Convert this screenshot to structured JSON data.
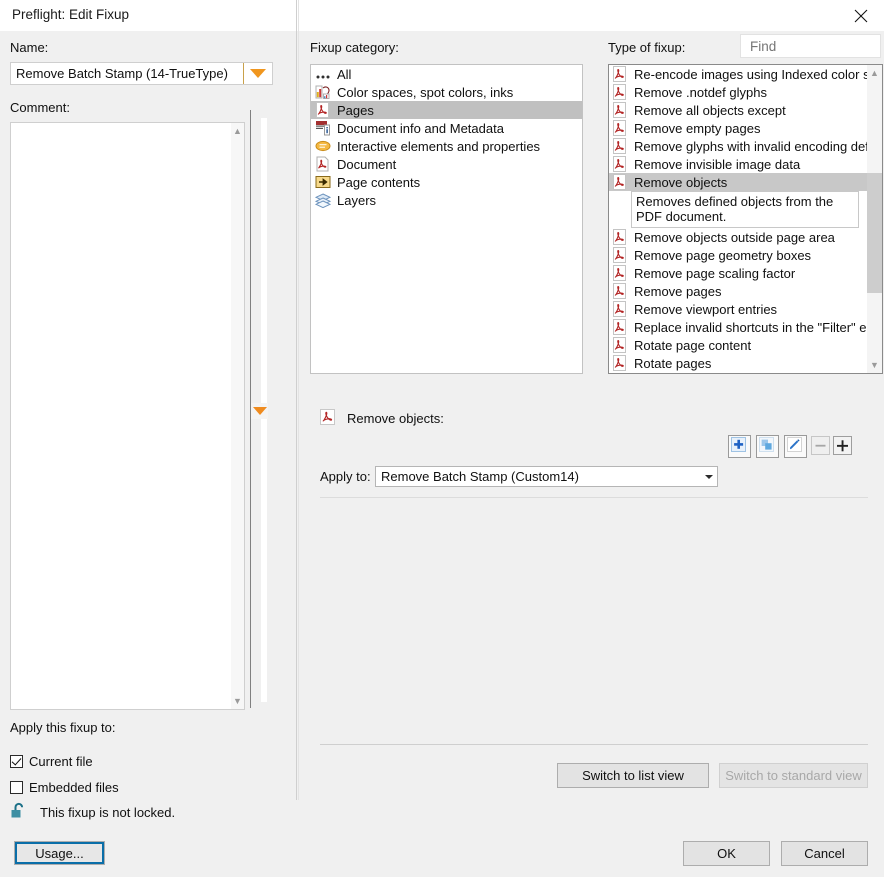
{
  "window": {
    "title": "Preflight: Edit Fixup",
    "close_icon": "close-icon"
  },
  "left_panel": {
    "name_label": "Name:",
    "name_value": "Remove Batch Stamp (14-TrueType)",
    "name_dropdown_icon": "chevron-down-icon",
    "comment_label": "Comment:",
    "comment_value": "",
    "apply_fixup_label": "Apply this fixup to:",
    "checkbox_current_file": {
      "label": "Current file",
      "checked": true
    },
    "checkbox_embedded_files": {
      "label": "Embedded files",
      "checked": false
    },
    "lock_icon": "unlocked-padlock-icon",
    "lock_text": "This fixup is not locked.",
    "usage_button": "Usage..."
  },
  "fixup_category": {
    "label": "Fixup category:",
    "items": [
      {
        "label": "All",
        "icon": "ellipsis-icon",
        "selected": false
      },
      {
        "label": "Color spaces, spot colors, inks",
        "icon": "color-swatch-icon",
        "selected": false
      },
      {
        "label": "Pages",
        "icon": "pdf-page-icon",
        "selected": true
      },
      {
        "label": "Document info and Metadata",
        "icon": "info-document-icon",
        "selected": false
      },
      {
        "label": "Interactive elements and properties",
        "icon": "comment-bubble-icon",
        "selected": false
      },
      {
        "label": "Document",
        "icon": "pdf-document-icon",
        "selected": false
      },
      {
        "label": "Page contents",
        "icon": "arrow-page-icon",
        "selected": false
      },
      {
        "label": "Layers",
        "icon": "layers-icon",
        "selected": false
      }
    ]
  },
  "type_of_fixup": {
    "label": "Type of fixup:",
    "find_placeholder": "Find",
    "find_value": "",
    "find_clear_icon": "clear-circle-icon",
    "scroll_up_icon": "chevron-up-icon",
    "scroll_down_icon": "chevron-down-icon",
    "items": [
      {
        "label": "Re-encode images using Indexed color space",
        "icon": "pdf-fixup-icon",
        "selected": false
      },
      {
        "label": "Remove .notdef glyphs",
        "icon": "pdf-fixup-icon",
        "selected": false
      },
      {
        "label": "Remove all objects except",
        "icon": "pdf-fixup-icon",
        "selected": false
      },
      {
        "label": "Remove empty pages",
        "icon": "pdf-fixup-icon",
        "selected": false
      },
      {
        "label": "Remove glyphs with invalid encoding definiti",
        "icon": "pdf-fixup-icon",
        "selected": false
      },
      {
        "label": "Remove invisible image data",
        "icon": "pdf-fixup-icon",
        "selected": false
      },
      {
        "label": "Remove objects",
        "icon": "pdf-fixup-icon",
        "selected": true
      },
      {
        "label": "Remove objects outside page area",
        "icon": "pdf-fixup-icon",
        "selected": false
      },
      {
        "label": "Remove page geometry boxes",
        "icon": "pdf-fixup-icon",
        "selected": false
      },
      {
        "label": "Remove page scaling factor",
        "icon": "pdf-fixup-icon",
        "selected": false
      },
      {
        "label": "Remove pages",
        "icon": "pdf-fixup-icon",
        "selected": false
      },
      {
        "label": "Remove viewport entries",
        "icon": "pdf-fixup-icon",
        "selected": false
      },
      {
        "label": "Replace invalid shortcuts in the \"Filter\" entry",
        "icon": "pdf-fixup-icon",
        "selected": false
      },
      {
        "label": "Rotate page content",
        "icon": "pdf-fixup-icon",
        "selected": false
      },
      {
        "label": "Rotate pages",
        "icon": "pdf-fixup-icon",
        "selected": false
      }
    ],
    "description": "Removes defined objects from the PDF document."
  },
  "detail": {
    "title": "Remove objects:",
    "title_icon": "pdf-fixup-icon",
    "apply_to_label": "Apply to:",
    "apply_to_value": "Remove Batch Stamp (Custom14)",
    "apply_to_dropdown_icon": "chevron-down-icon",
    "toolbar": [
      {
        "name": "add-button",
        "icon": "plus-square-icon",
        "enabled": true
      },
      {
        "name": "duplicate-button",
        "icon": "duplicate-squares-icon",
        "enabled": true
      },
      {
        "name": "edit-button",
        "icon": "pencil-icon",
        "enabled": true
      },
      {
        "name": "remove-button",
        "icon": "minus-icon",
        "enabled": false
      },
      {
        "name": "add-criterion-button",
        "icon": "plus-icon",
        "enabled": true
      }
    ]
  },
  "footer": {
    "switch_list_view": "Switch to list view",
    "switch_standard_view": "Switch to standard view",
    "switch_standard_view_enabled": false,
    "ok": "OK",
    "cancel": "Cancel"
  },
  "colors": {
    "accent_orange": "#f0961e",
    "selection_gray": "#c0c0c0",
    "focus_blue": "#0a6ea8",
    "pdf_icon_red": "#b32424"
  }
}
